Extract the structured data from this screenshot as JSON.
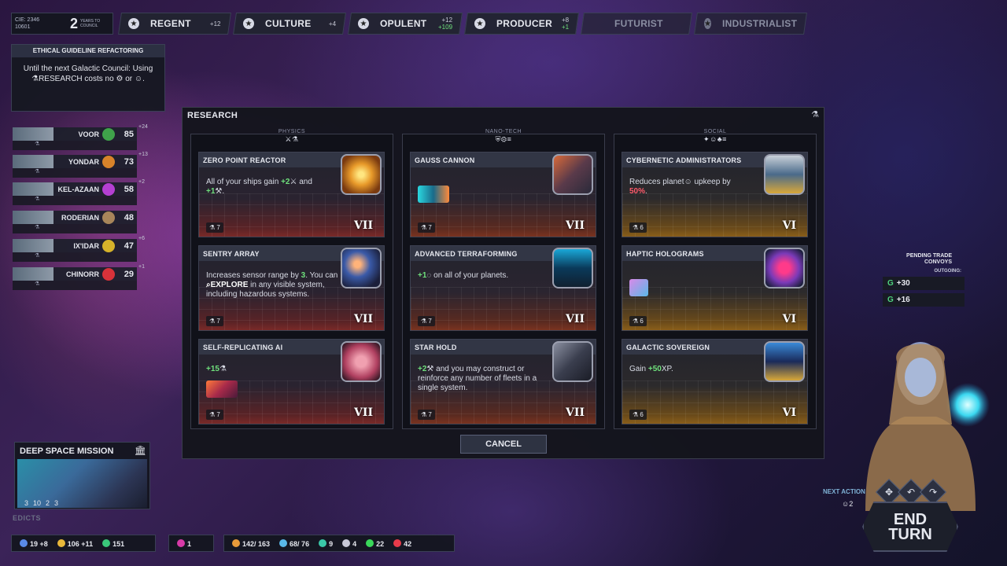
{
  "topbar": {
    "cie_line1": "CIE: 2346",
    "cie_line2": "10601",
    "years_num": "2",
    "years_label": "YEARS TO COUNCIL",
    "victories": [
      {
        "label": "REGENT",
        "val1": "+12",
        "val2": ""
      },
      {
        "label": "CULTURE",
        "val1": "+4",
        "val2": ""
      },
      {
        "label": "OPULENT",
        "val1": "+12",
        "val2": "+109"
      },
      {
        "label": "PRODUCER",
        "val1": "+8",
        "val2": "+1"
      },
      {
        "label": "FUTURIST",
        "val1": "",
        "val2": ""
      },
      {
        "label": "INDUSTRIALIST",
        "val1": "",
        "val2": ""
      }
    ]
  },
  "ethical": {
    "title": "ETHICAL GUIDELINE REFACTORING",
    "body": "Until the next Galactic Council: Using ⚗RESEARCH costs no ⚙ or ☺."
  },
  "empires": [
    {
      "name": "VOOR",
      "score": "85",
      "delta": "+24",
      "emblem": "#3fa34a"
    },
    {
      "name": "YONDAR",
      "score": "73",
      "delta": "+13",
      "emblem": "#d8832a"
    },
    {
      "name": "KEL-AZAAN",
      "score": "58",
      "delta": "+2",
      "emblem": "#b43fd2"
    },
    {
      "name": "RODERIAN",
      "score": "48",
      "delta": "",
      "emblem": "#a8855a"
    },
    {
      "name": "IX'IDAR",
      "score": "47",
      "delta": "+6",
      "emblem": "#d6b22a"
    },
    {
      "name": "CHINORR",
      "score": "29",
      "delta": "+1",
      "emblem": "#d8323a"
    }
  ],
  "research": {
    "title": "RESEARCH",
    "columns": [
      {
        "name": "PHYSICS",
        "icons": "⚔⚗"
      },
      {
        "name": "NANO-TECH",
        "icons": "⛨⚙≡"
      },
      {
        "name": "SOCIAL",
        "icons": "✦☺♣≡"
      }
    ],
    "cards": {
      "zpr": {
        "title": "ZERO POINT REACTOR",
        "d1": "All of your ships gain ",
        "d2": "+2",
        "d3": "⚔ and",
        "d4": "+1",
        "d5": "⚒.",
        "cost": "⚗ 7",
        "tier": "VII"
      },
      "sentry": {
        "title": "SENTRY ARRAY",
        "d1": "Increases sensor range by ",
        "d2": "3",
        "d3": ". You can ",
        "d4": "⌕EXPLORE",
        "d5": " in any visible system, including hazardous systems.",
        "cost": "⚗ 7",
        "tier": "VII"
      },
      "sra": {
        "title": "SELF-REPLICATING AI",
        "d1": "+15",
        "d2": "⚗",
        "cost": "⚗ 7",
        "tier": "VII"
      },
      "gauss": {
        "title": "GAUSS CANNON",
        "cost": "⚗ 7",
        "tier": "VII"
      },
      "terra": {
        "title": "ADVANCED TERRAFORMING",
        "d1": "+1",
        "d2": "◌ on all of your planets.",
        "cost": "⚗ 7",
        "tier": "VII"
      },
      "star": {
        "title": "STAR HOLD",
        "d1": "+2",
        "d2": "⚒ and you may construct or reinforce any number of fleets in a single system.",
        "cost": "⚗ 7",
        "tier": "VII"
      },
      "cyber": {
        "title": "CYBERNETIC ADMINISTRATORS",
        "d1": "Reduces planet",
        "d2": "☺ upkeep by",
        "d3": "50%",
        "d4": ".",
        "cost": "⚗ 6",
        "tier": "VI"
      },
      "haptic": {
        "title": "HAPTIC HOLOGRAMS",
        "cost": "⚗ 6",
        "tier": "VI"
      },
      "gal": {
        "title": "GALACTIC SOVEREIGN",
        "d1": "Gain ",
        "d2": "+50",
        "d3": "XP",
        "d4": ".",
        "cost": "⚗ 6",
        "tier": "VI"
      }
    },
    "cancel": "CANCEL"
  },
  "convoys": {
    "title": "PENDING TRADE CONVOYS",
    "outgoing": "OUTGOING:",
    "rows": [
      "+30",
      "+16"
    ]
  },
  "deep_space": {
    "title": "DEEP SPACE MISSION",
    "v1": "3",
    "v2": "10",
    "v3": "2",
    "v4": "3"
  },
  "edicts": "EDICTS",
  "resources": {
    "pop": "19 +8",
    "ind": "106 +11",
    "cred": "151",
    "inf": "1",
    "r1": "142/ 163",
    "r2": "68/ 76",
    "r3": "9",
    "r4": "4",
    "r5": "22",
    "r6": "42"
  },
  "next_action": {
    "label": "NEXT ACTION",
    "value": "☺2"
  },
  "end_turn": {
    "line1": "END",
    "line2": "TURN"
  }
}
